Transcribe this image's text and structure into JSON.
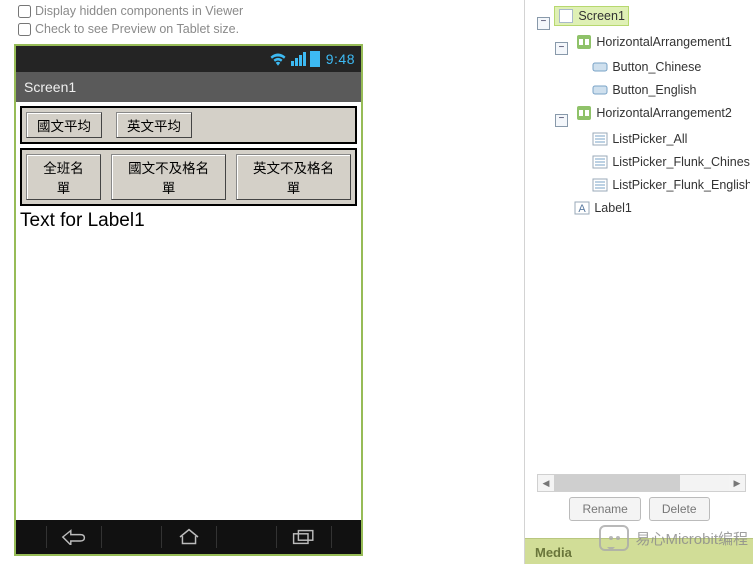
{
  "viewer_options": {
    "hidden_label": "Display hidden components in Viewer",
    "tablet_label": "Check to see Preview on Tablet size."
  },
  "phone": {
    "clock": "9:48",
    "title": "Screen1",
    "harr1": {
      "btn_chinese": "國文平均",
      "btn_english": "英文平均"
    },
    "harr2": {
      "lp_all": "全班名單",
      "lp_flunk_chinese": "國文不及格名單",
      "lp_flunk_english": "英文不及格名單"
    },
    "label1": "Text for Label1"
  },
  "tree": {
    "screen1": "Screen1",
    "ha1": "HorizontalArrangement1",
    "btn_cn": "Button_Chinese",
    "btn_en": "Button_English",
    "ha2": "HorizontalArrangement2",
    "lp_all": "ListPicker_All",
    "lp_fcn": "ListPicker_Flunk_Chinese",
    "lp_fen": "ListPicker_Flunk_English",
    "label1": "Label1"
  },
  "actions": {
    "rename": "Rename",
    "delete": "Delete"
  },
  "media_header": "Media",
  "watermark": "易心Microbit编程"
}
